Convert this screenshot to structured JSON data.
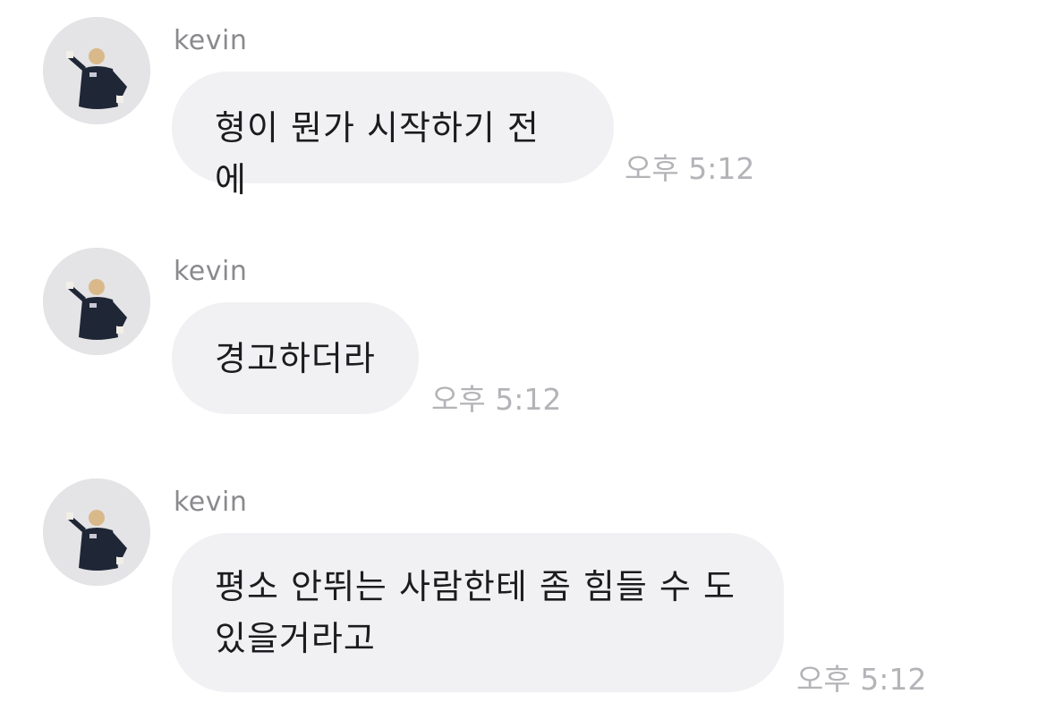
{
  "messages": [
    {
      "sender": "kevin",
      "text": "형이 뭔가 시작하기 전에",
      "time": "오후 5:12"
    },
    {
      "sender": "kevin",
      "text": "경고하더라",
      "time": "오후 5:12"
    },
    {
      "sender": "kevin",
      "text": "평소 안뛰는 사람한테 좀 힘들 수 도\n있을거라고",
      "time": "오후 5:12"
    }
  ],
  "colors": {
    "bubble": "#f1f1f4",
    "sender": "#8a8a8e",
    "time": "#b4b4b8",
    "text": "#1c1c1e"
  }
}
